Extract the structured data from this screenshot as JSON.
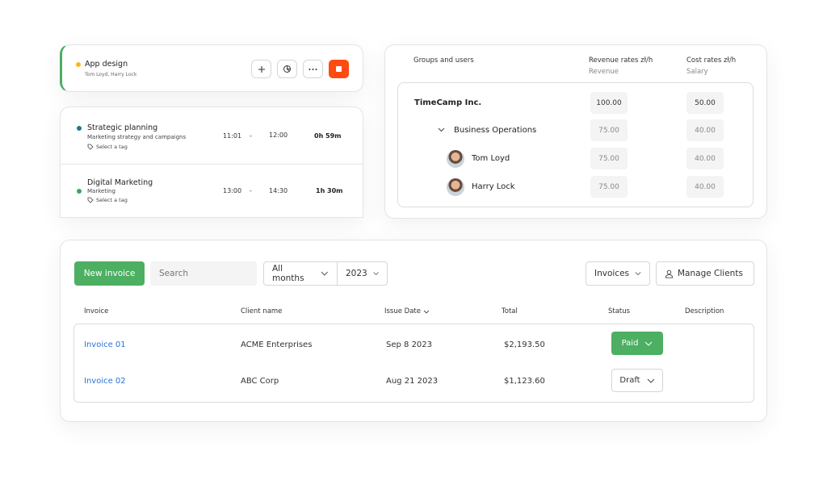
{
  "timer": {
    "title": "App design",
    "users": "Tom Loyd, Harry Lock",
    "dot_color": "#f5b921",
    "buttons": [
      "plus-icon",
      "pie-chart-icon",
      "more-icon",
      "stop-icon"
    ]
  },
  "entries": [
    {
      "name": "Strategic planning",
      "desc": "Marketing strategy and campaigns",
      "tag": "Select a tag",
      "start": "11:01",
      "dash": "-",
      "end": "12:00",
      "duration": "0h 59m",
      "dot_color": "#1f7a8c"
    },
    {
      "name": "Digital Marketing",
      "desc": "Marketing",
      "tag": "Select a tag",
      "start": "13:00",
      "dash": "-",
      "end": "14:30",
      "duration": "1h 30m",
      "dot_color": "#2fae5a"
    }
  ],
  "rates": {
    "col_groups": "Groups and users",
    "col_revenue": "Revenue rates zł/h",
    "col_revenue_sub": "Revenue",
    "col_cost": "Cost rates zł/h",
    "col_cost_sub": "Salary",
    "rows": [
      {
        "label": "TimeCamp Inc.",
        "revenue": "100.00",
        "cost": "50.00"
      },
      {
        "label": "Business Operations",
        "revenue": "75.00",
        "cost": "40.00"
      },
      {
        "label": "Tom Loyd",
        "revenue": "75.00",
        "cost": "40.00"
      },
      {
        "label": "Harry Lock",
        "revenue": "75.00",
        "cost": "40.00"
      }
    ]
  },
  "invoices": {
    "new_button": "New invoice",
    "search_placeholder": "Search",
    "month_filter": "All months",
    "year_filter": "2023",
    "type_filter": "Invoices",
    "manage_clients": "Manage Clients",
    "columns": {
      "invoice": "Invoice",
      "client": "Client name",
      "issue_date": "Issue Date",
      "total": "Total",
      "status": "Status",
      "description": "Description"
    },
    "rows": [
      {
        "invoice": "Invoice 01",
        "client": "ACME Enterprises",
        "date": "Sep 8 2023",
        "total": "$2,193.50",
        "status": "Paid"
      },
      {
        "invoice": "Invoice 02",
        "client": "ABC Corp",
        "date": "Aug 21 2023",
        "total": "$1,123.60",
        "status": "Draft"
      }
    ],
    "accent_color": "#4caf62",
    "link_color": "#2a72d8"
  }
}
